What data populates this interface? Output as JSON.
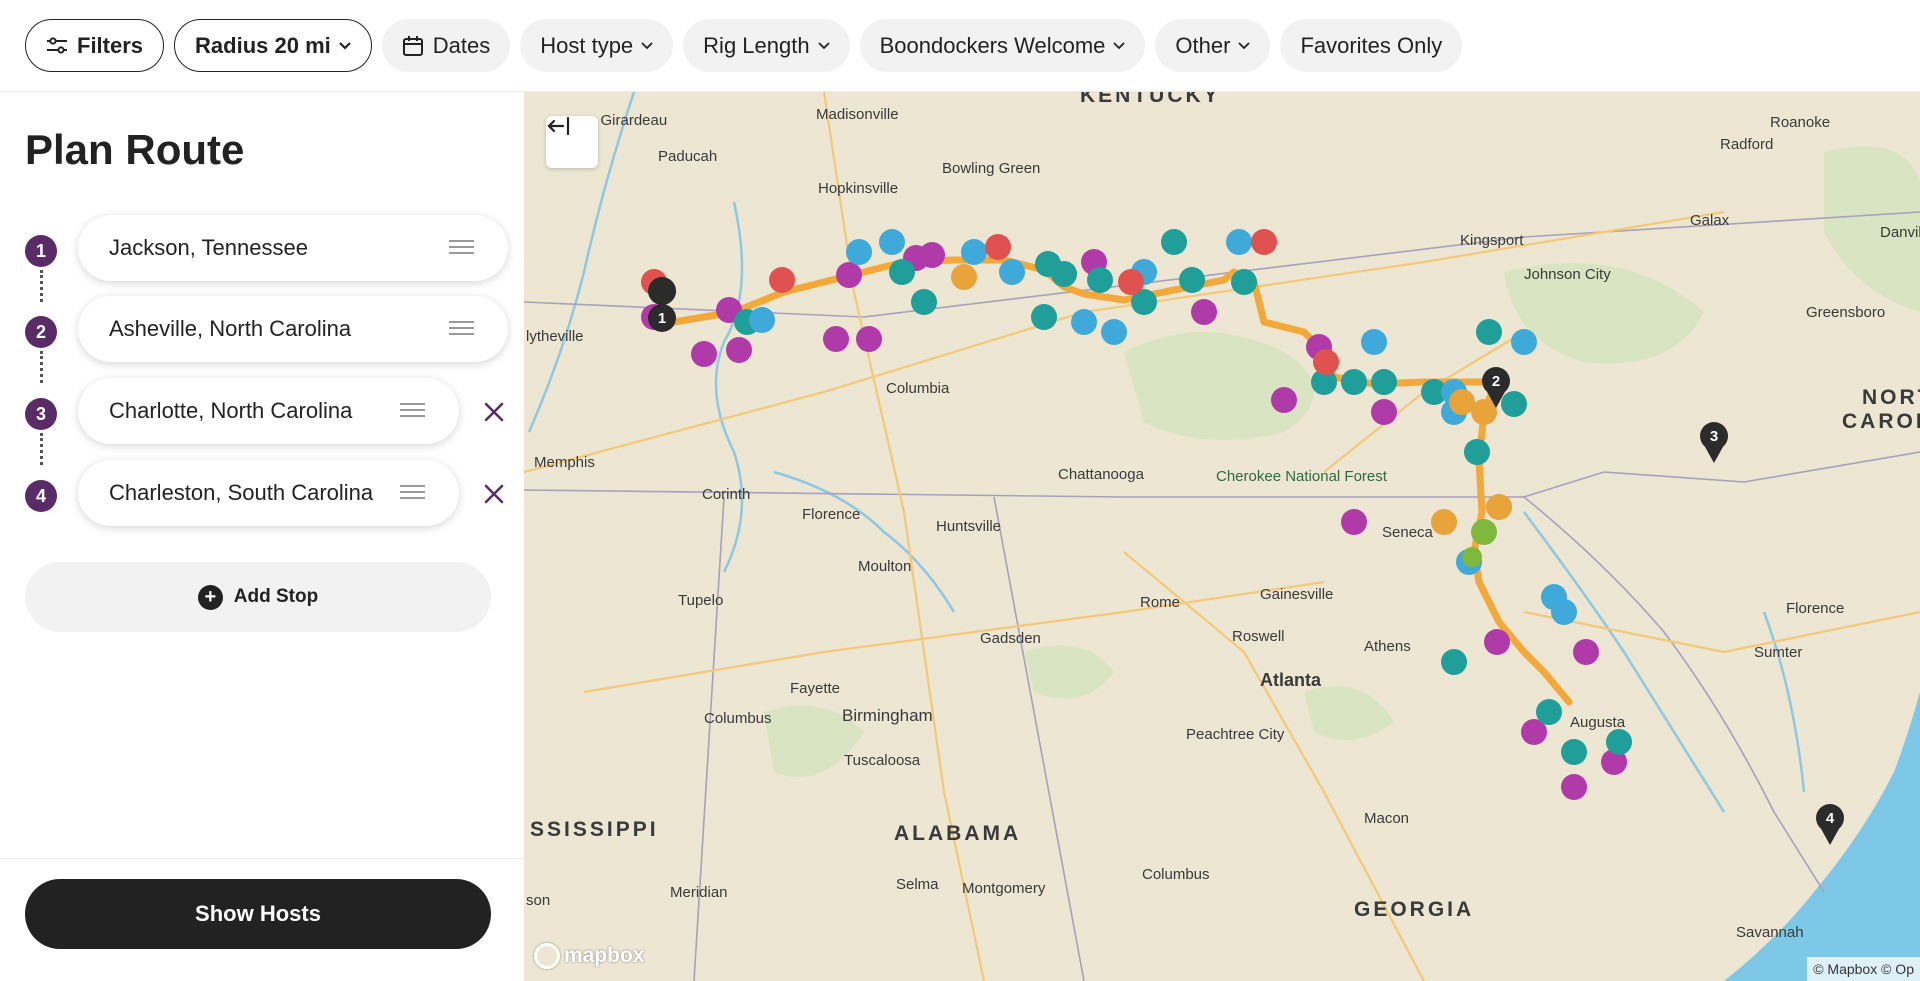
{
  "filters": {
    "filters_label": "Filters",
    "radius_label": "Radius 20 mi",
    "dates_label": "Dates",
    "host_type_label": "Host type",
    "rig_length_label": "Rig Length",
    "boondockers_label": "Boondockers Welcome",
    "other_label": "Other",
    "favorites_label": "Favorites Only"
  },
  "panel": {
    "title": "Plan Route",
    "stops": [
      {
        "number": "1",
        "name": "Jackson, Tennessee"
      },
      {
        "number": "2",
        "name": "Asheville, North Carolina"
      },
      {
        "number": "3",
        "name": "Charlotte, North Carolina"
      },
      {
        "number": "4",
        "name": "Charleston, South Carolina"
      }
    ],
    "add_stop_label": "Add Stop",
    "show_hosts_label": "Show Hosts"
  },
  "map": {
    "labels": {
      "kentucky": "KENTUCKY",
      "north_carolina_1": "NORT",
      "north_carolina_2": "CAROL",
      "mississippi": "SSISSIPPI",
      "alabama": "ALABAMA",
      "georgia": "GEORGIA",
      "paducah": "Paducah",
      "girardeau": "e Girardeau",
      "madisonville": "Madisonville",
      "bowling_green": "Bowling Green",
      "hopkinsville": "Hopkinsville",
      "kingsport": "Kingsport",
      "johnson_city": "Johnson City",
      "galax": "Galax",
      "radford": "Radford",
      "roanoke": "Roanoke",
      "danville": "Danvill",
      "greensboro": "Greensboro",
      "blytheville": "lytheville",
      "columbia_tn": "Columbia",
      "memphis": "Memphis",
      "corinth": "Corinth",
      "florence_al": "Florence",
      "huntsville": "Huntsville",
      "chattanooga": "Chattanooga",
      "cherokee": "Cherokee National Forest",
      "seneca": "Seneca",
      "moulton": "Moulton",
      "tupelo": "Tupelo",
      "rome": "Rome",
      "gainesville": "Gainesville",
      "florence_sc": "Florence",
      "sumter": "Sumter",
      "gadsden": "Gadsden",
      "roswell": "Roswell",
      "athens": "Athens",
      "atlanta": "Atlanta",
      "fayette": "Fayette",
      "birmingham": "Birmingham",
      "columbus_ms": "Columbus",
      "augusta": "Augusta",
      "peachtree": "Peachtree City",
      "tuscaloosa": "Tuscaloosa",
      "macon": "Macon",
      "meridian": "Meridian",
      "selma": "Selma",
      "montgomery": "Montgomery",
      "columbus_ga": "Columbus",
      "savannah": "Savannah",
      "son": "son"
    },
    "attribution": "© Mapbox © Op",
    "logo_text": "mapbox"
  },
  "colors": {
    "accent": "#5a2c67",
    "route": "#f4a93a",
    "dark": "#222222",
    "marker_teal": "#1f9e9a",
    "marker_blue": "#3fa9d9",
    "marker_purple": "#b03aa8",
    "marker_red": "#e0524f",
    "marker_orange": "#e8a33a"
  }
}
